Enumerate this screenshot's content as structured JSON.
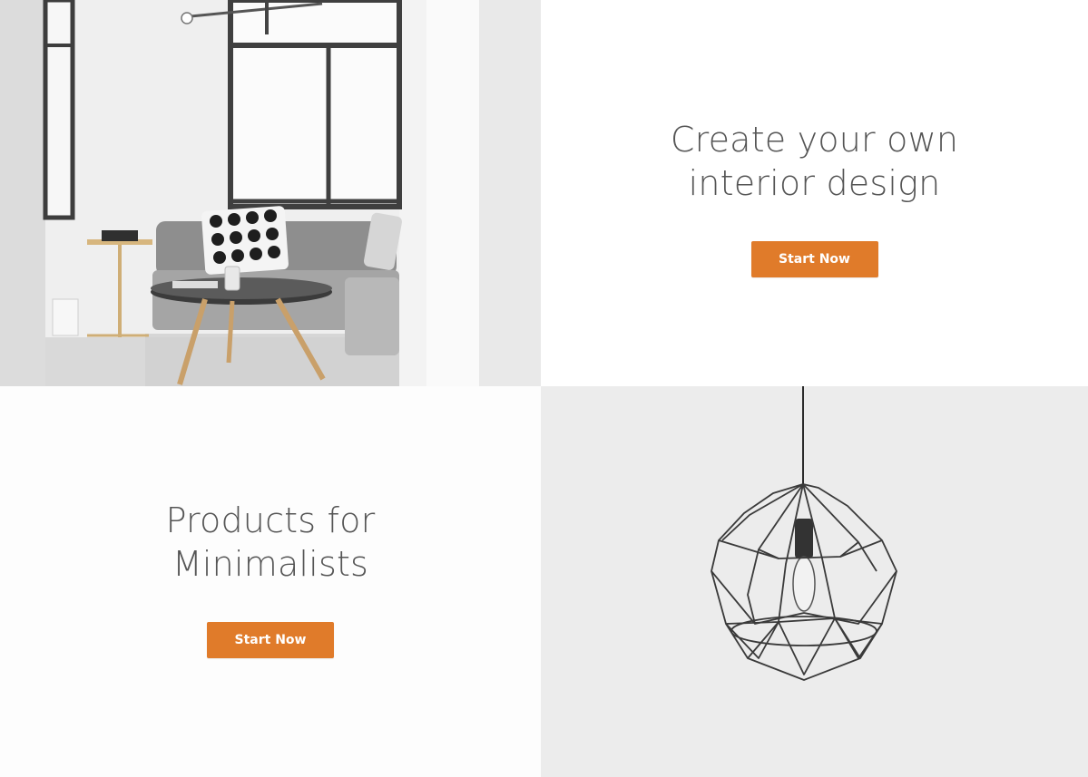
{
  "sections": [
    {
      "image": "living-room-photo",
      "title_lines": []
    },
    {
      "image": "",
      "title_lines": [
        "Create your own",
        "interior design"
      ],
      "button_label": "Start Now"
    },
    {
      "image": "",
      "title_lines": [
        "Products for",
        "Minimalists"
      ],
      "button_label": "Start Now"
    },
    {
      "image": "pendant-lamp-photo",
      "title_lines": []
    }
  ],
  "colors": {
    "accent": "#e07b2a",
    "heading_text": "#555555",
    "button_text": "#ffffff"
  }
}
